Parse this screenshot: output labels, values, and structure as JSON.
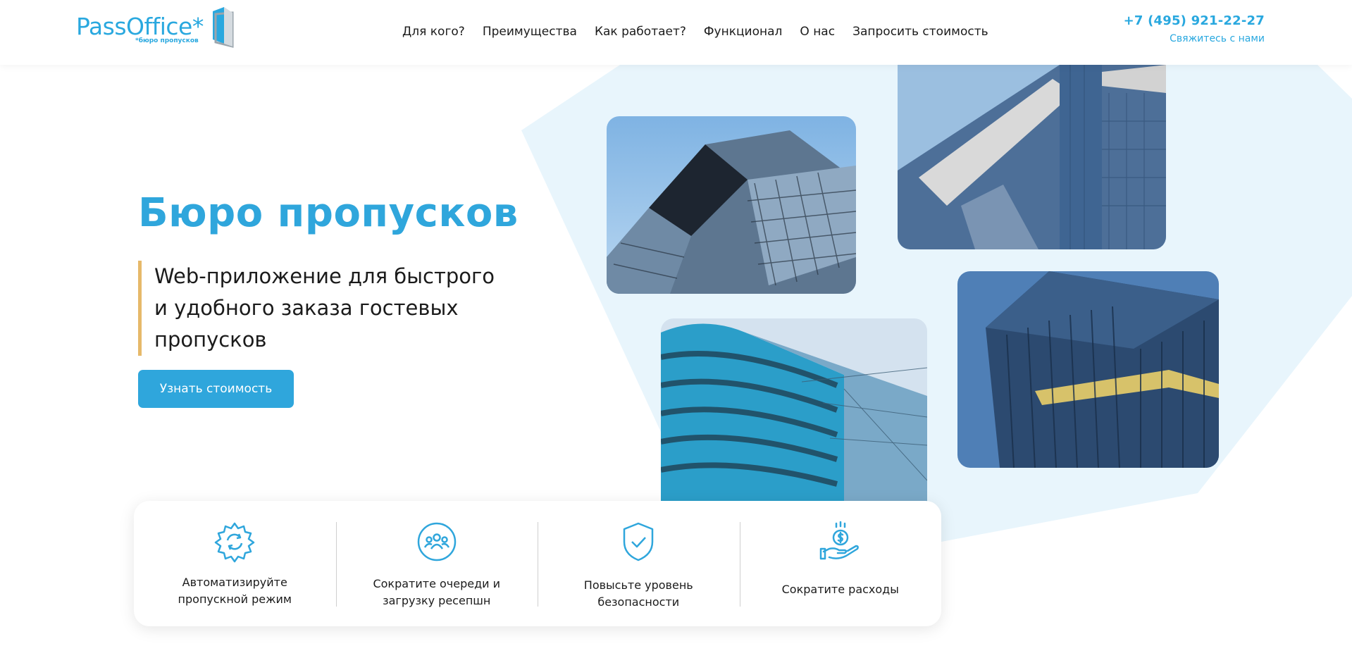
{
  "header": {
    "logo": {
      "name": "PassOffice*",
      "tagline": "*бюро пропусков"
    },
    "nav": [
      {
        "label": "Для кого?"
      },
      {
        "label": "Преимущества"
      },
      {
        "label": "Как работает?"
      },
      {
        "label": "Функционал"
      },
      {
        "label": "О нас"
      },
      {
        "label": "Запросить стоимость"
      }
    ],
    "phone": "+7 (495) 921-22-27",
    "contact_link": "Свяжитесь с нами"
  },
  "hero": {
    "title": "Бюро пропусков",
    "subtitle_lines": [
      "Web-приложение для быстрого",
      "и удобного заказа гостевых",
      "пропусков"
    ],
    "cta_label": "Узнать стоимость"
  },
  "features": [
    {
      "icon": "gear-sync-icon",
      "line1": "Автоматизируйте",
      "line2": "пропускной режим"
    },
    {
      "icon": "people-group-icon",
      "line1": "Сократите очереди и",
      "line2": "загрузку ресепшн"
    },
    {
      "icon": "shield-check-icon",
      "line1": "Повысьте уровень",
      "line2": "безопасности"
    },
    {
      "icon": "money-hand-icon",
      "line1": "Сократите расходы",
      "line2": ""
    }
  ],
  "colors": {
    "accent": "#2fa6dc",
    "accent_border": "#e6b96a",
    "hex_background": "#e8f5fc"
  }
}
